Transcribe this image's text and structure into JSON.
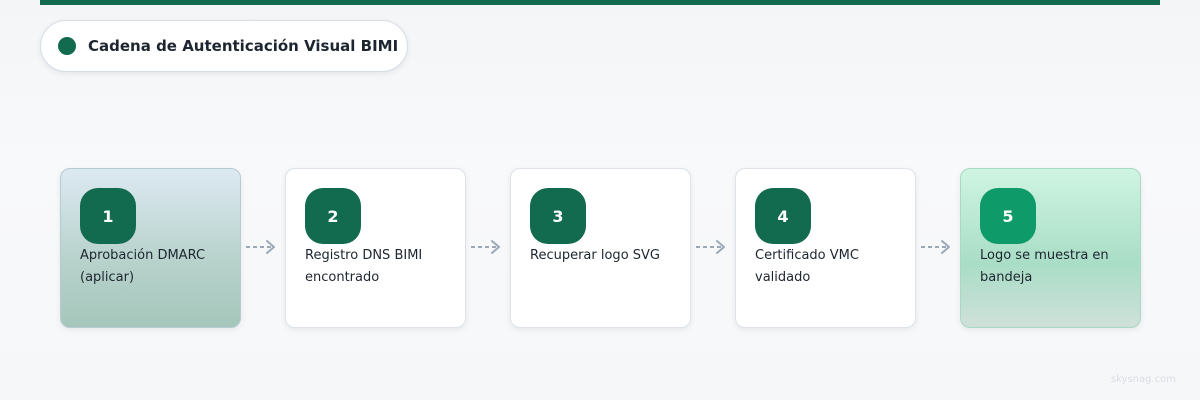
{
  "header": {
    "title": "Cadena de Autenticación Visual BIMI"
  },
  "steps": [
    {
      "number": "1",
      "label": "Aprobación DMARC (aplicar)"
    },
    {
      "number": "2",
      "label": "Registro DNS BIMI encontrado"
    },
    {
      "number": "3",
      "label": "Recuperar logo SVG"
    },
    {
      "number": "4",
      "label": "Certificado VMC validado"
    },
    {
      "number": "5",
      "label": "Logo se muestra en bandeja"
    }
  ],
  "colors": {
    "accent": "#136b4f",
    "final_accent": "#0e9a69",
    "arrow": "#9aa8b8"
  },
  "watermark": "skysnag.com"
}
